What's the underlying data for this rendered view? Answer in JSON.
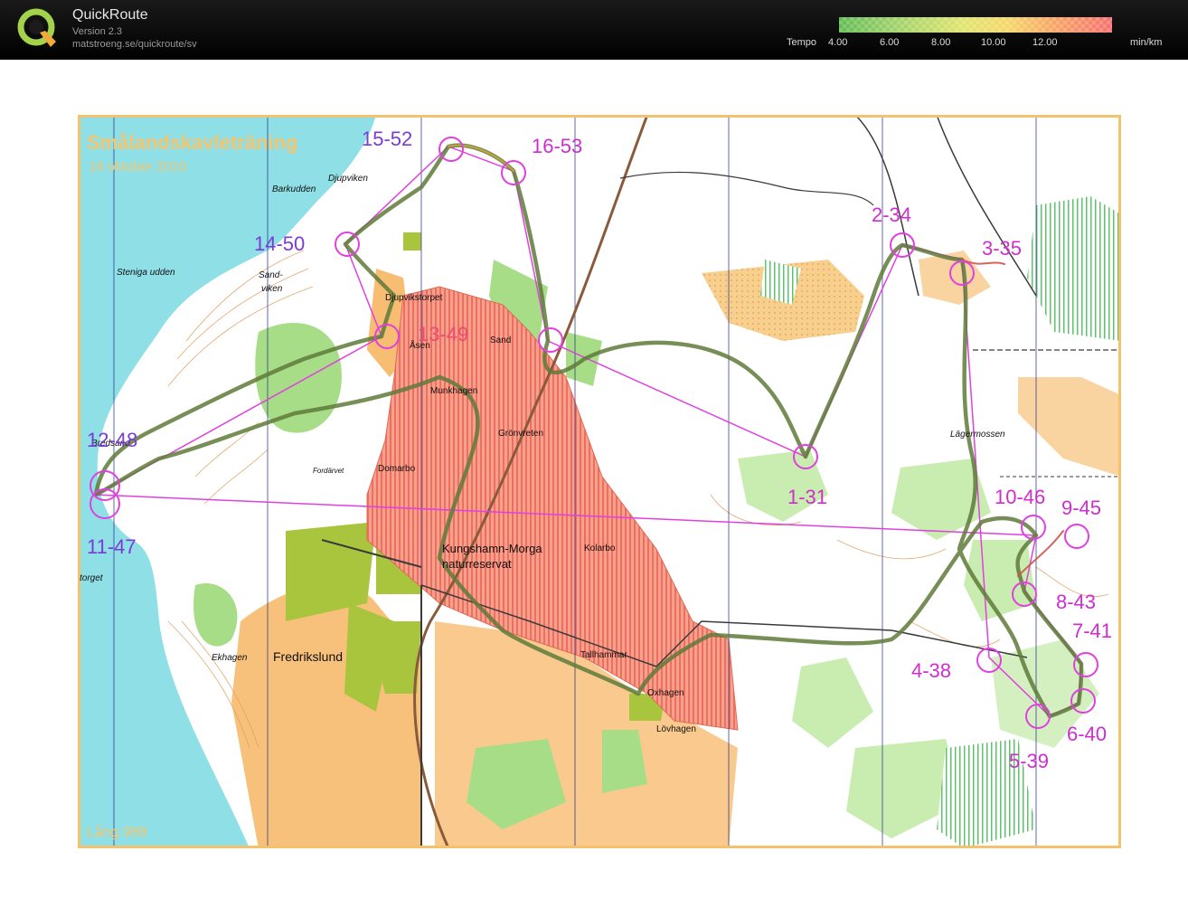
{
  "app": {
    "title": "QuickRoute",
    "version": "Version 2.3",
    "url": "matstroeng.se/quickroute/sv",
    "logo_letter": "Q"
  },
  "tempo": {
    "label": "Tempo",
    "ticks": [
      "4.00",
      "6.00",
      "8.00",
      "10.00",
      "12.00"
    ],
    "unit": "min/km",
    "gradient_colors": [
      "#63bc55",
      "#9fd16a",
      "#dfe56e",
      "#f6d76a",
      "#f7a865",
      "#f57270"
    ]
  },
  "map": {
    "title": "Smålandskavleträning",
    "date": "19 oktober 2010",
    "course": "Lång 988",
    "colors": {
      "water": "#8fdfe6",
      "forest": "#ffffff",
      "open": "#f7bd72",
      "reserve": "#f38a78",
      "green": "#a6dc86",
      "olive": "#a7c23a",
      "route": "#5f7a3a",
      "course": "#e040e0",
      "frame": "#f3c26f"
    },
    "place_names": [
      "Djupviken",
      "Barkudden",
      "Steniga udden",
      "Sand-",
      "viken",
      "Djupvikstorpet",
      "Åsen",
      "Sand",
      "Munkhagen",
      "Grönvreten",
      "Domarbo",
      "Bredsand",
      "Kungshamn-Morga",
      "naturreservat",
      "Kolarbo",
      "Fredrikslund",
      "Ekhagen",
      "Tallhammar",
      "Oxhagen",
      "Lövhagen",
      "Lägermossen",
      "Fordärvet",
      "torget"
    ],
    "controls": [
      "1-31",
      "2-34",
      "3-35",
      "4-38",
      "5-39",
      "6-40",
      "7-41",
      "8-43",
      "9-45",
      "10-46",
      "11-47",
      "12-48",
      "13-49",
      "14-50",
      "15-52",
      "16-53"
    ]
  }
}
